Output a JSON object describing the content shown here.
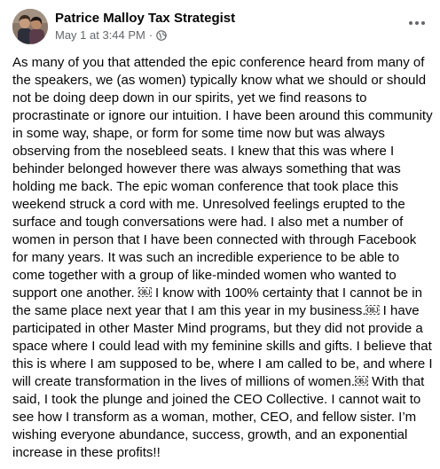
{
  "post": {
    "author": "Patrice Malloy Tax Strategist",
    "timestamp": "May 1 at 3:44 PM",
    "separator": "·",
    "privacy_icon": "globe-icon",
    "menu_icon": "more-horizontal-icon",
    "body": "As many of you that attended the epic conference heard from many of the speakers, we (as women) typically know what we should or should not be doing deep down in our spirits, yet we find reasons to procrastinate or ignore our intuition. I have been around this community in some way, shape, or form for some time now but was always observing from the nosebleed seats. I knew that this was where I behinder belonged however there was always something that was holding me back. The epic woman conference that took place this weekend struck a cord with me. Unresolved feelings erupted to the surface and tough conversations were had. I also met a number of women in person that I have been connected with through Facebook for many years. It was such an incredible experience to be able to come together with a group of like-minded women who wanted to support one another. ￼ I know with 100% certainty that I cannot be in the same place next year that I am this year in my business.￼ I have participated in other Master Mind programs, but they did not provide a space where I could lead with my feminine skills and gifts. I believe that this is where I am supposed to be, where I am called to be, and where I will create transformation in the lives of millions of women.￼ With that said, I took the plunge and joined the CEO Collective. I cannot wait to see how I transform as a woman, mother, CEO, and fellow sister. I’m wishing everyone abundance, success, growth, and an exponential increase in these profits!!"
  },
  "colors": {
    "text": "#050505",
    "secondary_text": "#65676b",
    "background": "#ffffff"
  }
}
